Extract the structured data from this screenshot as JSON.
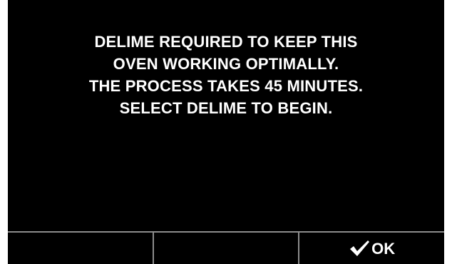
{
  "message": {
    "lines": [
      "DELIME REQUIRED TO KEEP THIS",
      "OVEN WORKING OPTIMALLY.",
      "THE PROCESS TAKES 45 MINUTES.",
      "SELECT DELIME TO BEGIN."
    ]
  },
  "softkeys": {
    "left_label": "",
    "middle_label": "",
    "right_label": "OK",
    "right_icon": "check-icon"
  },
  "colors": {
    "background": "#000000",
    "text": "#ffffff",
    "divider": "#8c8c8c"
  }
}
